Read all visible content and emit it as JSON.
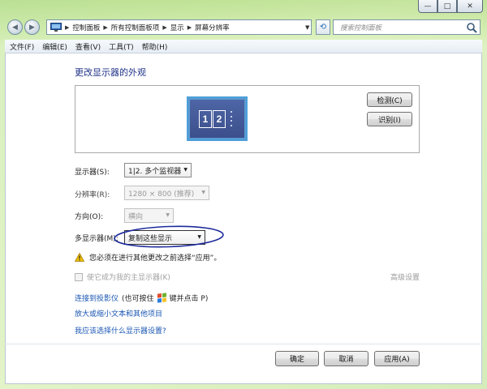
{
  "window": {
    "min_glyph": "—",
    "max_glyph": "□",
    "close_glyph": "✕"
  },
  "address": {
    "crumbs": [
      "控制面板",
      "所有控制面板项",
      "显示",
      "屏幕分辨率"
    ],
    "search_placeholder": "搜索控制面板"
  },
  "menu": [
    "文件(F)",
    "编辑(E)",
    "查看(V)",
    "工具(T)",
    "帮助(H)"
  ],
  "main": {
    "title": "更改显示器的外观",
    "monitor_numbers": [
      "1",
      "2"
    ],
    "detect_label": "检测(C)",
    "identify_label": "识别(I)",
    "fields": {
      "display_label": "显示器(S):",
      "display_value": "1|2. 多个监视器",
      "resolution_label": "分辨率(R):",
      "resolution_value": "1280 × 800 (推荐)",
      "orientation_label": "方向(O):",
      "orientation_value": "横向",
      "multi_label": "多显示器(M):",
      "multi_value": "复制这些显示"
    },
    "warning": "您必须在进行其他更改之前选择“应用”。",
    "primary_checkbox": "使它成为我的主显示器(K)",
    "advanced": "高级设置",
    "projector_link": "连接到投影仪",
    "projector_hint_pre": "(也可按住",
    "projector_hint_post": "键并点击 P)",
    "text_size_link": "放大或缩小文本和其他项目",
    "which_link": "我应该选择什么显示器设置?"
  },
  "buttons": {
    "ok": "确定",
    "cancel": "取消",
    "apply": "应用(A)"
  },
  "colors": {
    "title": "#1e3287",
    "link": "#1a56b3",
    "annotation": "#1c2a9a",
    "warning": "#f2c200"
  }
}
